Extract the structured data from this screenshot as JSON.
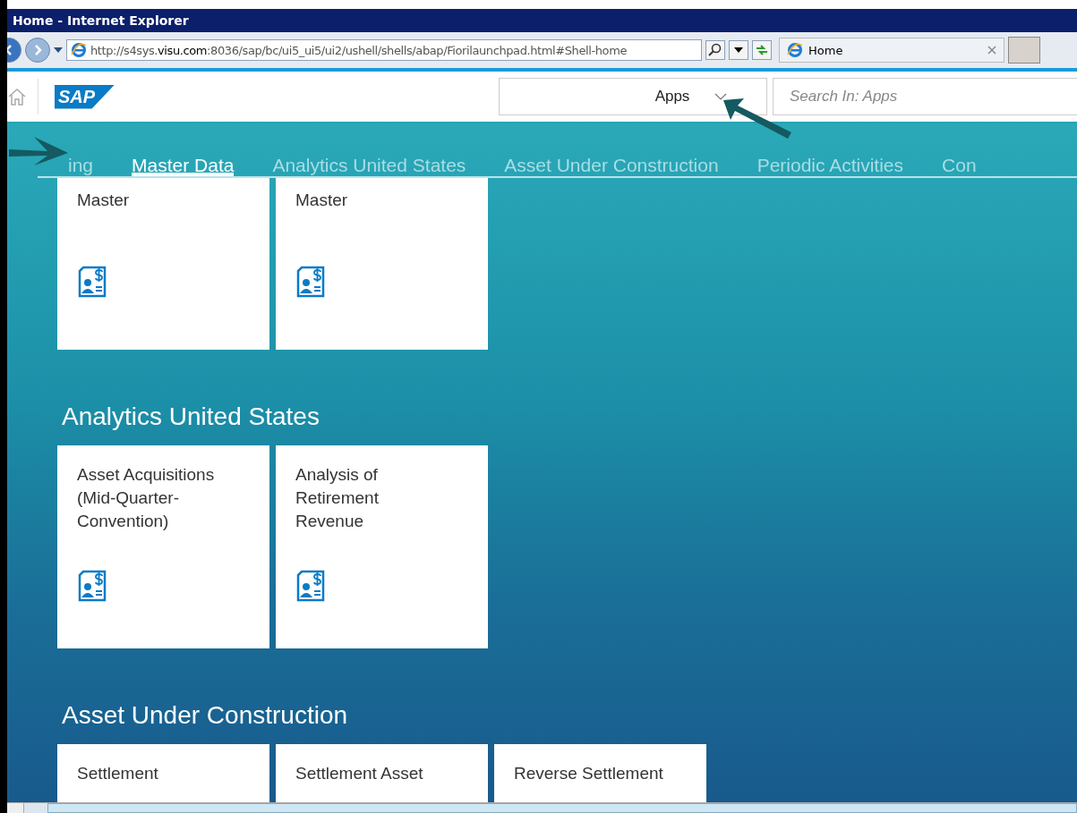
{
  "window": {
    "title": "Home - Internet Explorer"
  },
  "address_bar": {
    "url_prefix": "http://s4sys.",
    "url_domain": "visu.com",
    "url_rest": ":8036/sap/bc/ui5_ui5/ui2/ushell/shells/abap/Fiorilaunchpad.html#Shell-home",
    "tab_title": "Home"
  },
  "shell": {
    "logo": "SAP",
    "scope": "Apps",
    "search": {
      "placeholder": "Search In: Apps"
    }
  },
  "tabs": [
    {
      "label": "ing",
      "selected": false
    },
    {
      "label": "Master Data",
      "selected": true
    },
    {
      "label": "Analytics United States",
      "selected": false
    },
    {
      "label": "Asset Under Construction",
      "selected": false
    },
    {
      "label": "Periodic Activities",
      "selected": false
    },
    {
      "label": "Con",
      "selected": false
    }
  ],
  "groups": [
    {
      "tiles": [
        {
          "title": "Master"
        },
        {
          "title": "Master"
        }
      ]
    },
    {
      "title": "Analytics United States",
      "tiles": [
        {
          "title": "Asset Acquisitions (Mid-Quarter-Convention)"
        },
        {
          "title": "Analysis of Retirement Revenue"
        }
      ]
    },
    {
      "title": "Asset Under Construction",
      "tiles": [
        {
          "title": "Settlement"
        },
        {
          "title": "Settlement Asset"
        },
        {
          "title": "Reverse Settlement"
        }
      ]
    }
  ]
}
